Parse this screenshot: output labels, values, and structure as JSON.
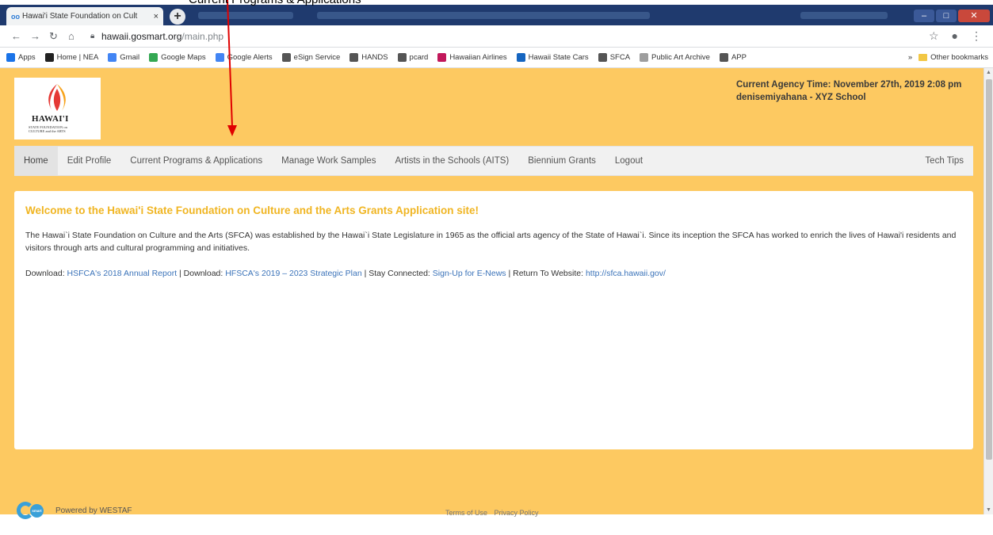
{
  "annotation": {
    "partial_text": "Current Programs & Applications"
  },
  "browser": {
    "tab_title": "Hawai'i State Foundation on Cult",
    "tab_close": "×",
    "new_tab": "+",
    "url_host": "hawaii.gosmart.org",
    "url_path": "/main.php",
    "bookmarks": [
      {
        "label": "Apps",
        "icon": "apps-icon",
        "color": "#1a73e8"
      },
      {
        "label": "Home | NEA",
        "icon": "nea-icon",
        "color": "#222222"
      },
      {
        "label": "Gmail",
        "icon": "google-icon",
        "color": "#4285f4"
      },
      {
        "label": "Google Maps",
        "icon": "maps-icon",
        "color": "#34a853"
      },
      {
        "label": "Google Alerts",
        "icon": "google-icon",
        "color": "#4285f4"
      },
      {
        "label": "eSign Service",
        "icon": "seal-icon",
        "color": "#555555"
      },
      {
        "label": "HANDS",
        "icon": "seal-icon",
        "color": "#555555"
      },
      {
        "label": "pcard",
        "icon": "globe-icon",
        "color": "#555555"
      },
      {
        "label": "Hawaiian Airlines",
        "icon": "flower-icon",
        "color": "#c2185b"
      },
      {
        "label": "Hawaii State Cars",
        "icon": "disk-icon",
        "color": "#1565c0"
      },
      {
        "label": "SFCA",
        "icon": "seal-icon",
        "color": "#555555"
      },
      {
        "label": "Public Art Archive",
        "icon": "doc-icon",
        "color": "#9e9e9e"
      },
      {
        "label": "APP",
        "icon": "globe-icon",
        "color": "#555555"
      }
    ],
    "more_bookmarks": "»",
    "other_bookmarks": "Other bookmarks"
  },
  "header": {
    "logo_word": "HAWAI'I",
    "logo_sub": "STATE FOUNDATION on CULTURE and the ARTS",
    "agency_time": "Current Agency Time: November 27th, 2019 2:08 pm",
    "user": "denisemiyahana - XYZ School"
  },
  "menu": {
    "items": [
      "Home",
      "Edit Profile",
      "Current Programs & Applications",
      "Manage Work Samples",
      "Artists in the Schools (AITS)",
      "Biennium Grants",
      "Logout"
    ],
    "right": "Tech Tips"
  },
  "content": {
    "welcome": "Welcome to the Hawai'i State Foundation on Culture and the Arts Grants Application site!",
    "para": "The Hawai`i State Foundation on Culture and the Arts (SFCA) was established by the Hawai`i State Legislature in 1965 as the official arts agency of the State of Hawai`i. Since its inception the SFCA has worked to enrich the lives of Hawai'i residents and visitors through arts and cultural programming and initiatives.",
    "download1_label": "Download: ",
    "download1_link": "HSFCA's 2018 Annual Report",
    "download2_label": " | Download: ",
    "download2_link": "HFSCA's 2019 – 2023 Strategic Plan",
    "stay_label": " | Stay Connected: ",
    "stay_link": "Sign-Up for E-News",
    "return_label": "  | Return To Website: ",
    "return_link": "http://sfca.hawaii.gov/"
  },
  "footer": {
    "go_logo_text": "smart",
    "powered": "Powered by WESTAF",
    "terms": "Terms of Use",
    "privacy": "Privacy Policy"
  },
  "colors": {
    "page_bg": "#fdc961",
    "welcome": "#f0b522",
    "link": "#3b73b9",
    "arrow": "#e00000"
  }
}
